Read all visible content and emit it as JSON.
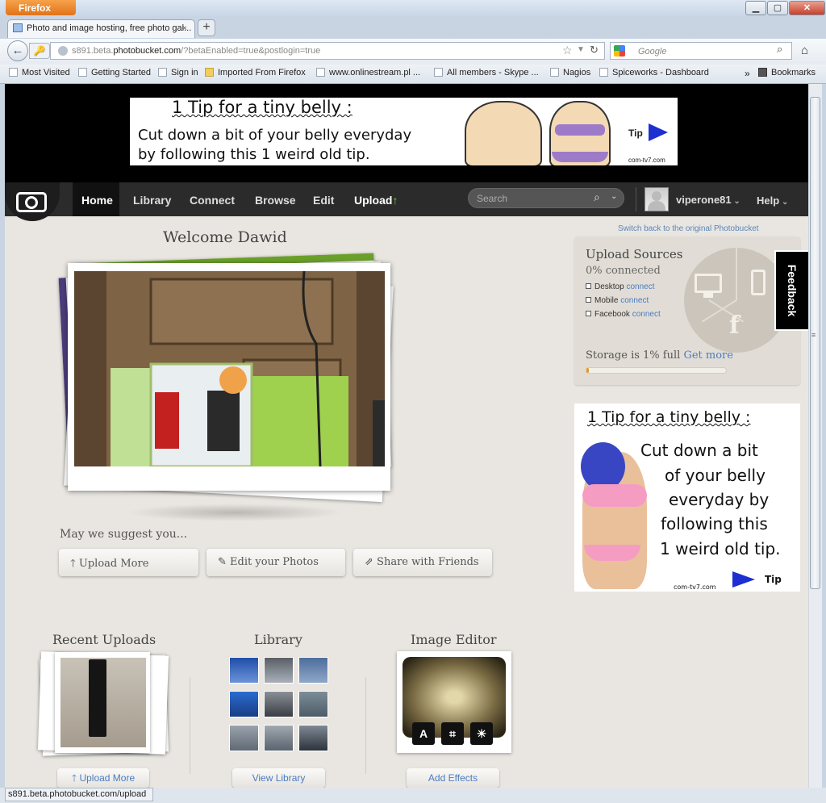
{
  "browser": {
    "menu_button": "Firefox",
    "window_controls": {
      "minimize": "▁",
      "maximize": "▢",
      "close": "✕"
    },
    "tab": {
      "title": "Photo and image hosting, free photo gal...",
      "close": "×"
    },
    "new_tab": "+",
    "url": {
      "prefix": "s891.beta.",
      "domain": "photobucket.com",
      "rest": "/?betaEnabled=true&postlogin=true"
    },
    "search_placeholder": "Google",
    "bookmarks": [
      {
        "label": "Most Visited",
        "icon": "page-icon"
      },
      {
        "label": "Getting Started",
        "icon": "page-icon"
      },
      {
        "label": "Sign in",
        "icon": "page-icon"
      },
      {
        "label": "Imported From Firefox",
        "icon": "folder-icon"
      },
      {
        "label": "www.onlinestream.pl ...",
        "icon": "page-icon"
      },
      {
        "label": "All members - Skype ...",
        "icon": "page-icon"
      },
      {
        "label": "Nagios",
        "icon": "page-icon"
      },
      {
        "label": "Spiceworks - Dashboard",
        "icon": "page-icon"
      }
    ],
    "bookmarks_overflow": "»",
    "bookmarks_menu": "Bookmarks",
    "status_text": "s891.beta.photobucket.com/upload"
  },
  "ad_top": {
    "headline": "1 Tip for a tiny belly :",
    "line1": "Cut down a bit of your belly everyday",
    "line2": "by following this 1 weird old tip.",
    "tip": "Tip",
    "domain": "com-tv7.com"
  },
  "nav": {
    "items": [
      "Home",
      "Library",
      "Connect",
      "Browse",
      "Edit",
      "Upload"
    ],
    "upload_arrow": "↑",
    "search_placeholder": "Search",
    "username": "viperone81",
    "help": "Help"
  },
  "switch_back": "Switch back to the original Photobucket",
  "welcome": "Welcome Dawid",
  "suggest": {
    "title": "May we suggest you...",
    "buttons": [
      {
        "label": "Upload More",
        "icon": "upload-arrow-icon",
        "glyph": "🡑"
      },
      {
        "label": "Edit your Photos",
        "icon": "edit-icon",
        "glyph": "✎"
      },
      {
        "label": "Share with Friends",
        "icon": "share-icon",
        "glyph": "⇗"
      }
    ]
  },
  "upload_sources": {
    "title": "Upload Sources",
    "connected": "0% connected",
    "sources": [
      {
        "name": "Desktop",
        "action": "connect"
      },
      {
        "name": "Mobile",
        "action": "connect"
      },
      {
        "name": "Facebook",
        "action": "connect"
      }
    ],
    "storage_text": "Storage is 1% full",
    "get_more": "Get more",
    "storage_fraction": 0.01
  },
  "feedback": "Feedback",
  "ad_side": {
    "headline": "1 Tip for a tiny belly :",
    "lines": [
      "Cut down a bit",
      "of your belly",
      "everyday by",
      "following this",
      "1 weird old tip."
    ],
    "domain": "com-tv7.com",
    "tip": "Tip"
  },
  "sections": {
    "recent": {
      "title": "Recent Uploads",
      "button": "Upload More",
      "button_glyph": "🡑"
    },
    "library": {
      "title": "Library",
      "button": "View Library"
    },
    "editor": {
      "title": "Image Editor",
      "button": "Add Effects",
      "tools": [
        "A",
        "⌗",
        "☀"
      ]
    }
  },
  "colors": {
    "link": "#4a7cc0",
    "nav_bg": "#2b2b2b",
    "storage_fill": "#e89b1b",
    "page_bg": "#e9e6e1"
  }
}
